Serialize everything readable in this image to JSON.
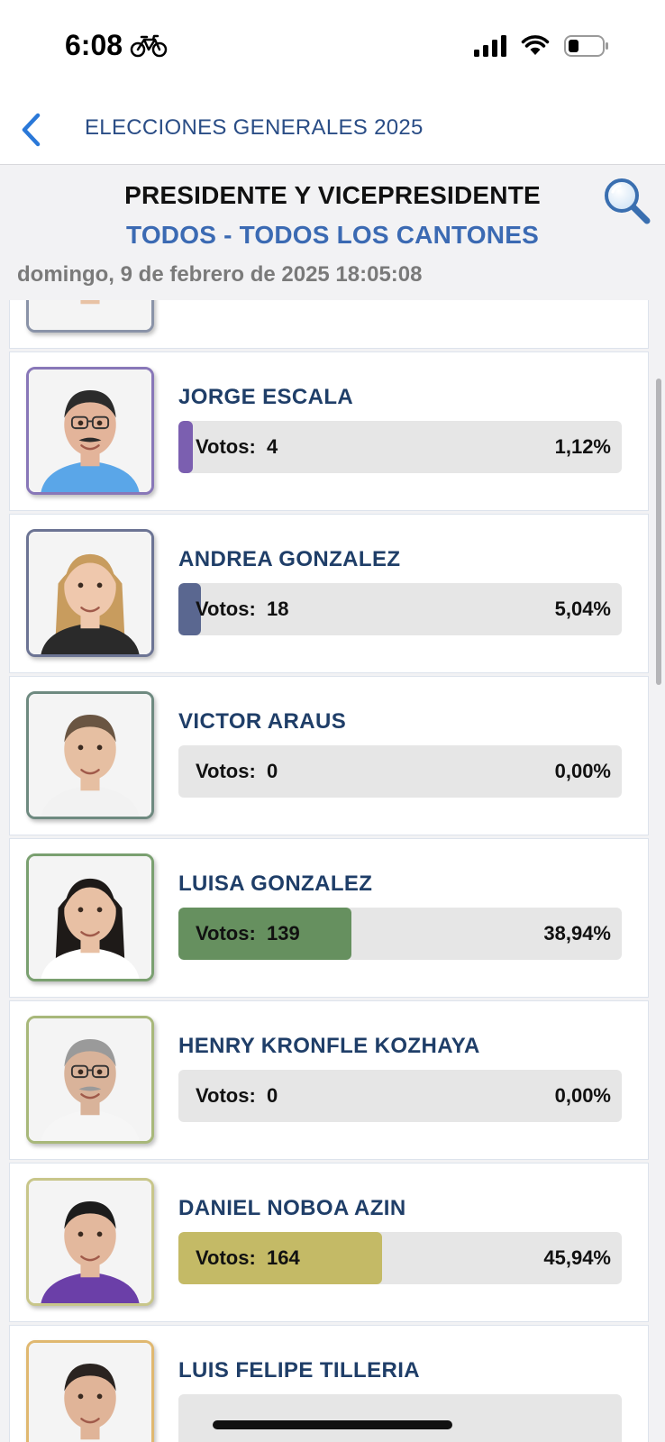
{
  "status_bar": {
    "time": "6:08",
    "activity_icon": "bicycle-icon",
    "signal_icon": "cellular-signal-icon",
    "wifi_icon": "wifi-icon",
    "battery_icon": "battery-icon"
  },
  "nav": {
    "back_icon": "chevron-left-icon",
    "title": "ELECCIONES GENERALES 2025"
  },
  "header": {
    "title": "PRESIDENTE Y VICEPRESIDENTE",
    "subtitle": "TODOS - TODOS LOS CANTONES",
    "date": "domingo, 9 de febrero de 2025 18:05:08",
    "search_icon": "search-icon"
  },
  "votes_label": "Votos:",
  "candidates": [
    {
      "name": "",
      "votes": "",
      "percent": "",
      "share": 0,
      "bar_color": "#9aa9c2",
      "frame_color": "#8a93a8",
      "partial": "top"
    },
    {
      "name": "JORGE ESCALA",
      "votes": "4",
      "percent": "1,12%",
      "share": 0.0112,
      "bar_color": "#7b5fb0",
      "frame_color": "#8877b8"
    },
    {
      "name": "ANDREA GONZALEZ",
      "votes": "18",
      "percent": "5,04%",
      "share": 0.0504,
      "bar_color": "#5a6790",
      "frame_color": "#6c7494"
    },
    {
      "name": "VICTOR ARAUS",
      "votes": "0",
      "percent": "0,00%",
      "share": 0,
      "bar_color": "#6a8a7e",
      "frame_color": "#6e8a80"
    },
    {
      "name": "LUISA GONZALEZ",
      "votes": "139",
      "percent": "38,94%",
      "share": 0.3894,
      "bar_color": "#66905f",
      "frame_color": "#7aa070"
    },
    {
      "name": "HENRY KRONFLE KOZHAYA",
      "votes": "0",
      "percent": "0,00%",
      "share": 0,
      "bar_color": "#a8b87a",
      "frame_color": "#a8b87a"
    },
    {
      "name": "DANIEL NOBOA AZIN",
      "votes": "164",
      "percent": "45,94%",
      "share": 0.4594,
      "bar_color": "#c4ba66",
      "frame_color": "#c8c68a"
    },
    {
      "name": "LUIS FELIPE TILLERIA",
      "votes": "",
      "percent": "",
      "share": 0,
      "bar_color": "#e0a860",
      "frame_color": "#e0b870",
      "partial": "bottom"
    }
  ],
  "colors": {
    "accent_blue": "#3b6ab3",
    "nav_title": "#2a4d86",
    "name_text": "#1f3e68",
    "background": "#f2f2f4"
  }
}
